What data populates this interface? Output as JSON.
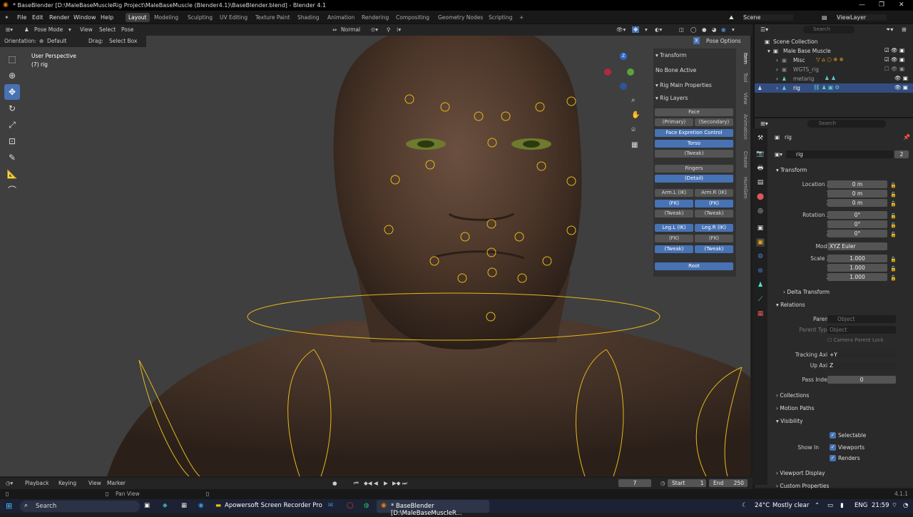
{
  "title": "* BaseBlender [D:\\MaleBaseMuscleRig Project\\MaleBaseMuscle (Blender4.1)\\BaseBlender.blend] - Blender 4.1",
  "menu": [
    "File",
    "Edit",
    "Render",
    "Window",
    "Help"
  ],
  "workspaces": [
    "Layout",
    "Modeling",
    "Sculpting",
    "UV Editing",
    "Texture Paint",
    "Shading",
    "Animation",
    "Rendering",
    "Compositing",
    "Geometry Nodes",
    "Scripting"
  ],
  "scene": "Scene",
  "view_layer": "ViewLayer",
  "header": {
    "mode": "Pose Mode",
    "view": "View",
    "select": "Select",
    "pose": "Pose",
    "orientation_label": "Orientation:",
    "orientation": "Default",
    "drag_label": "Drag:",
    "drag": "Select Box",
    "transform_orient": "Normal",
    "pose_options": "Pose Options"
  },
  "viewport": {
    "perspective": "User Perspective",
    "object": "(7) rig"
  },
  "rig_panel": {
    "transform": "Transform",
    "no_bone": "No Bone Active",
    "main_props": "Rig Main Properties",
    "rig_layers": "Rig Layers",
    "buttons": {
      "face": "Face",
      "primary": "(Primary)",
      "secondary": "(Secondary)",
      "face_exp": "Face Expretion Control",
      "torso": "Torso",
      "tweak": "(Tweak)",
      "fingers": "Fingers",
      "detail": "(Detail)",
      "arml_ik": "Arm.L (IK)",
      "armr_ik": "Arm.R (IK)",
      "fk": "(FK)",
      "legl_ik": "Leg.L (IK)",
      "legr_ik": "Leg.R (IK)",
      "root": "Root"
    }
  },
  "vtabs": [
    "Item",
    "Tool",
    "View",
    "Animation",
    "Create",
    "HumGen"
  ],
  "outliner": {
    "search": "Search",
    "rows": [
      "Scene Collection",
      "Male Base Muscle",
      "Misc",
      "WGTS_rig",
      "metarig",
      "rig"
    ]
  },
  "props": {
    "search": "Search",
    "object": "rig",
    "data_name": "rig",
    "users": "2",
    "transform": "Transform",
    "location_x": "Location X",
    "loc_x": "0 m",
    "y": "Y",
    "loc_y": "0 m",
    "z": "Z",
    "loc_z": "0 m",
    "rotation_x": "Rotation X",
    "rot_x": "0°",
    "rot_y": "0°",
    "rot_z": "0°",
    "mode_label": "Mode",
    "mode": "XYZ Euler",
    "scale_x": "Scale X",
    "sc_x": "1.000",
    "sc_y": "1.000",
    "sc_z": "1.000",
    "delta": "Delta Transform",
    "relations": "Relations",
    "parent": "Parent",
    "parent_val": "Object",
    "parent_type": "Parent Type",
    "parent_type_val": "Object",
    "camera_lock": "Camera Parent Lock",
    "tracking": "Tracking Axis",
    "tracking_val": "+Y",
    "up": "Up Axis",
    "up_val": "Z",
    "pass": "Pass Index",
    "pass_val": "0",
    "collections": "Collections",
    "motion": "Motion Paths",
    "visibility": "Visibility",
    "selectable": "Selectable",
    "show_in": "Show In",
    "viewports": "Viewports",
    "renders": "Renders",
    "viewport_display": "Viewport Display",
    "custom": "Custom Properties"
  },
  "timeline": {
    "playback": "Playback",
    "keying": "Keying",
    "view": "View",
    "marker": "Marker",
    "frame": "7",
    "start_label": "Start",
    "start": "1",
    "end_label": "End",
    "end": "250"
  },
  "status": {
    "pan": "Pan View",
    "version": "4.1.1"
  },
  "taskbar": {
    "search": "Search",
    "app1": "Apowersoft Screen Recorder Pro",
    "app2": "* BaseBlender [D:\\MaleBaseMuscleR...",
    "weather": "24°C",
    "weather_desc": "Mostly clear",
    "lang": "ENG",
    "time": "21:59"
  }
}
